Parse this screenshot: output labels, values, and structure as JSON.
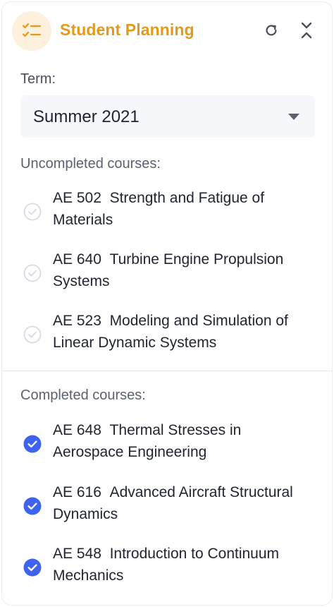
{
  "header": {
    "title": "Student Planning",
    "icon": "checklist-icon",
    "actions": [
      "refresh-icon",
      "collapse-icon"
    ],
    "accent_color": "#e39a1c"
  },
  "term": {
    "label": "Term:",
    "selected": "Summer 2021"
  },
  "uncompleted": {
    "label": "Uncompleted courses:",
    "items": [
      {
        "code": "AE 502",
        "name": "Strength and Fatigue of Materials"
      },
      {
        "code": "AE 640",
        "name": "Turbine Engine Propulsion Systems"
      },
      {
        "code": "AE 523",
        "name": "Modeling and Simulation of Linear Dynamic Systems"
      }
    ]
  },
  "completed": {
    "label": "Completed courses:",
    "items": [
      {
        "code": "AE 648",
        "name": "Thermal Stresses in Aerospace Engineering"
      },
      {
        "code": "AE 616",
        "name": "Advanced Aircraft Structural Dynamics"
      },
      {
        "code": "AE 548",
        "name": "Introduction to Continuum Mechanics"
      }
    ],
    "check_color": "#3d63f0"
  }
}
